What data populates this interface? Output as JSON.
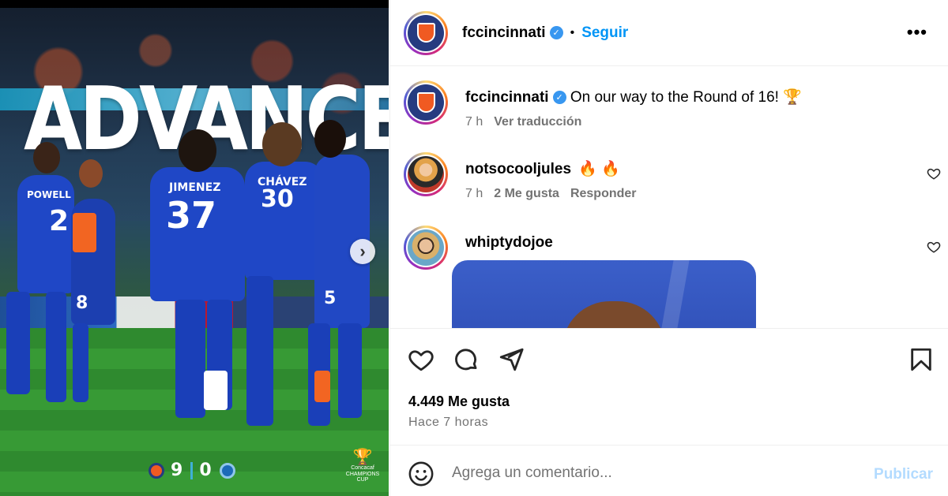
{
  "post_media": {
    "headline": "ADVANCED",
    "players": [
      {
        "name": "POWELL",
        "number": "2"
      },
      {
        "name": "JIMENEZ",
        "number": "37"
      },
      {
        "name": "CHÁVEZ",
        "number": "30"
      },
      {
        "name": "",
        "number": "5"
      },
      {
        "name": "",
        "number": "8"
      }
    ],
    "score": {
      "home": "9",
      "away": "0"
    },
    "competition_logo_text": "Concacaf CHAMPIONS CUP",
    "next_icon": "chevron-right-icon"
  },
  "header": {
    "username": "fccincinnati",
    "separator": "•",
    "follow_label": "Seguir",
    "more_icon": "•••"
  },
  "caption": {
    "username": "fccincinnati",
    "text": "On our way to the Round of 16! 🏆",
    "time": "7 h",
    "translate_label": "Ver traducción"
  },
  "comments": [
    {
      "username": "notsocooljules",
      "text": "🔥 🔥",
      "time": "7 h",
      "likes_label": "2 Me gusta",
      "reply_label": "Responder"
    },
    {
      "username": "whiptydojoe",
      "text": ""
    }
  ],
  "engagement": {
    "likes": "4.449 Me gusta",
    "posted": "Hace 7 horas"
  },
  "composer": {
    "placeholder": "Agrega un comentario...",
    "publish_label": "Publicar"
  },
  "colors": {
    "accent_blue": "#0095f6",
    "publish_disabled": "#b3dbff",
    "verified": "#3897f0",
    "meta_gray": "#737373"
  }
}
